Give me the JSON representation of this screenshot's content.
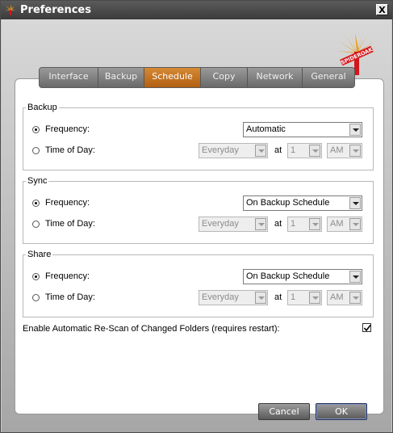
{
  "window": {
    "title": "Preferences",
    "close_label": "X"
  },
  "tabs": [
    {
      "label": "Interface",
      "active": false
    },
    {
      "label": "Backup",
      "active": false
    },
    {
      "label": "Schedule",
      "active": true
    },
    {
      "label": "Copy",
      "active": false
    },
    {
      "label": "Network",
      "active": false
    },
    {
      "label": "General",
      "active": false
    }
  ],
  "logo": {
    "text": "SPIDEROAK",
    "accent": "#e8a020",
    "brand": "#d4161b"
  },
  "groups": {
    "backup": {
      "title": "Backup",
      "frequency_label": "Frequency:",
      "frequency_value": "Automatic",
      "time_label": "Time of Day:",
      "day_value": "Everyday",
      "at_label": "at",
      "hour_value": "1",
      "ampm_value": "AM",
      "selected": "frequency"
    },
    "sync": {
      "title": "Sync",
      "frequency_label": "Frequency:",
      "frequency_value": "On Backup Schedule",
      "time_label": "Time of Day:",
      "day_value": "Everyday",
      "at_label": "at",
      "hour_value": "1",
      "ampm_value": "AM",
      "selected": "frequency"
    },
    "share": {
      "title": "Share",
      "frequency_label": "Frequency:",
      "frequency_value": "On Backup Schedule",
      "time_label": "Time of Day:",
      "day_value": "Everyday",
      "at_label": "at",
      "hour_value": "1",
      "ampm_value": "AM",
      "selected": "frequency"
    }
  },
  "rescan": {
    "label": "Enable Automatic Re-Scan of Changed Folders (requires restart):",
    "checked": true
  },
  "buttons": {
    "cancel": "Cancel",
    "ok": "OK"
  }
}
